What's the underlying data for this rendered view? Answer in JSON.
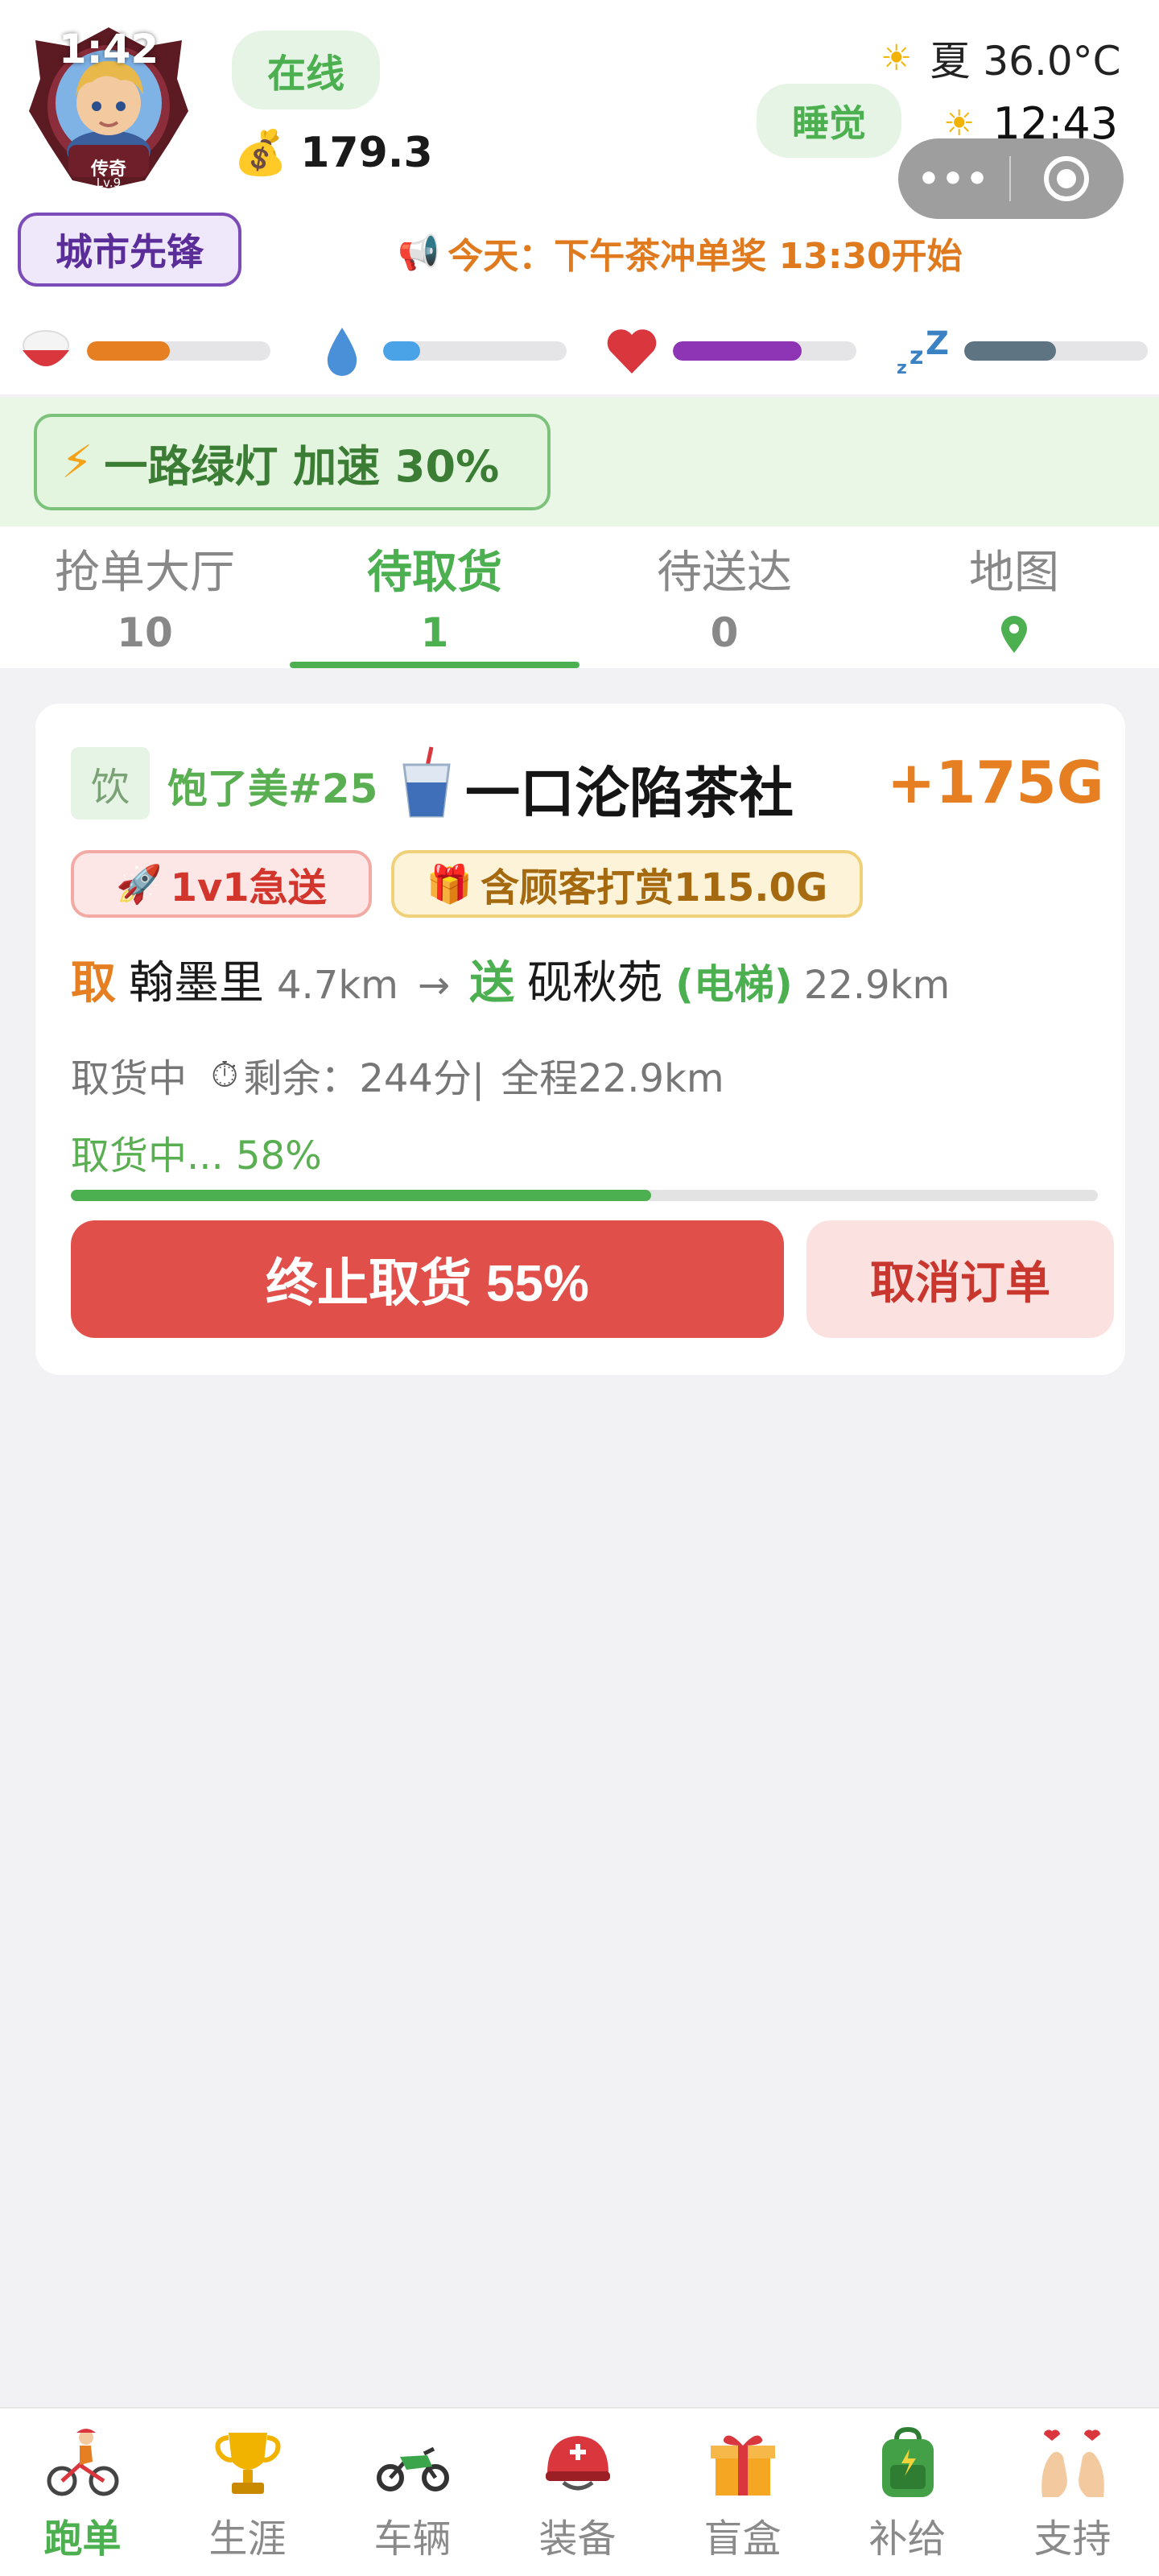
{
  "header": {
    "avatar": {
      "time": "1:42",
      "rank": "传奇",
      "level": "Lv.9"
    },
    "online_label": "在线",
    "money": {
      "icon": "money-bag-icon",
      "value": "179.3"
    },
    "sleep_label": "睡觉",
    "weather": {
      "icon": "sun-icon",
      "text": "夏 36.0°C"
    },
    "clock": {
      "icon": "sun-icon",
      "time": "12:43"
    },
    "title_badge": "城市先锋",
    "announcement": "今天：下午茶冲单奖 13:30开始",
    "stats": [
      {
        "name": "food",
        "icon": "rice-bowl-icon",
        "level": 0.45,
        "color": "#e67e22"
      },
      {
        "name": "water",
        "icon": "water-drop-icon",
        "level": 0.2,
        "color": "#4aa3e6"
      },
      {
        "name": "health",
        "icon": "heart-icon",
        "level": 0.7,
        "color": "#8e35b5"
      },
      {
        "name": "sleep",
        "icon": "zzz-icon",
        "level": 0.5,
        "color": "#5f7483"
      }
    ]
  },
  "buff": {
    "icon": "lightning-icon",
    "text": "一路绿灯 加速 30%"
  },
  "tabs": [
    {
      "label": "抢单大厅",
      "count": "10"
    },
    {
      "label": "待取货",
      "count": "1",
      "active": true
    },
    {
      "label": "待送达",
      "count": "0"
    },
    {
      "label": "地图",
      "icon": "map-pin-icon"
    }
  ],
  "order": {
    "category": "饮",
    "shop_code": "饱了美#25",
    "shop_icon": "drink-cup-icon",
    "shop_name": "一口沦陷茶社",
    "reward": "+175G",
    "tags": [
      {
        "icon": "rocket-icon",
        "text": "1v1急送"
      },
      {
        "icon": "gift-icon",
        "text": "含顾客打赏115.0G"
      }
    ],
    "route": {
      "pickup_label": "取",
      "pickup_place": "翰墨里",
      "pickup_distance": "4.7km",
      "arrow": "→",
      "dropoff_label": "送",
      "dropoff_place": "砚秋苑",
      "dropoff_note": "(电梯)",
      "dropoff_distance": "22.9km"
    },
    "status": "取货中",
    "timer_icon": "stopwatch-icon",
    "remaining": "剩余：244分|",
    "total": "全程22.9km",
    "progress_label": "取货中... 58%",
    "progress": 0.565,
    "stop_button": "终止取货 55%",
    "cancel_button": "取消订单"
  },
  "nav": [
    {
      "label": "跑单",
      "icon": "cyclist-icon",
      "active": true
    },
    {
      "label": "生涯",
      "icon": "trophy-icon"
    },
    {
      "label": "车辆",
      "icon": "motorcycle-icon"
    },
    {
      "label": "装备",
      "icon": "helmet-icon"
    },
    {
      "label": "盲盒",
      "icon": "gift-box-icon"
    },
    {
      "label": "补给",
      "icon": "backpack-icon"
    },
    {
      "label": "支持",
      "icon": "finger-heart-icon"
    }
  ],
  "colors": {
    "accent": "#4caf50",
    "danger": "#e14f4a",
    "reward": "#e67e22",
    "badge_purple": "#7b4bb8"
  }
}
